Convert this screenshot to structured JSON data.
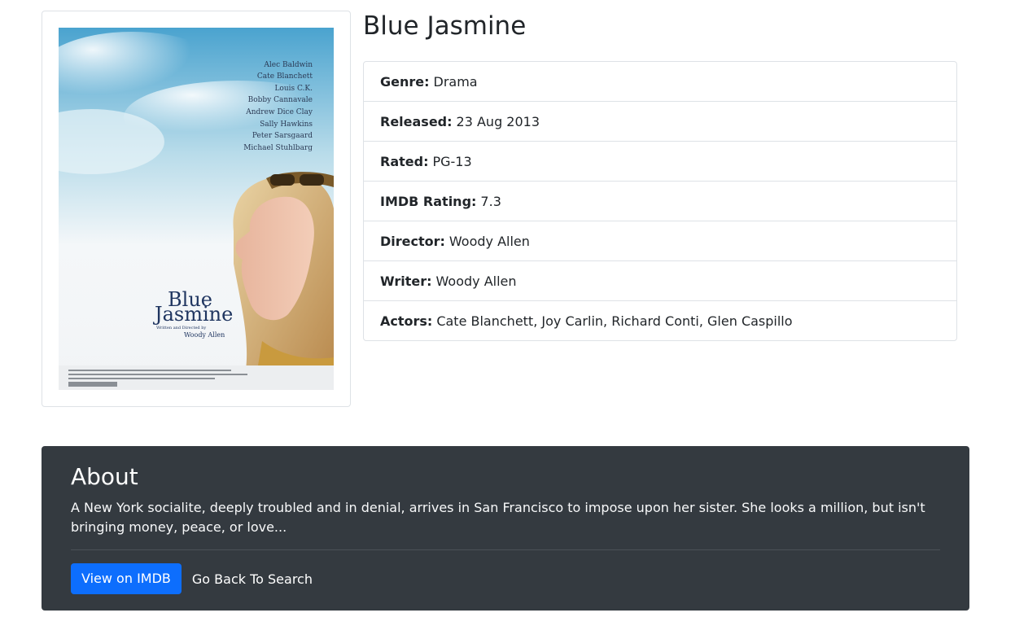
{
  "movie": {
    "title": "Blue Jasmine",
    "poster": {
      "cast": [
        "Alec Baldwin",
        "Cate Blanchett",
        "Louis C.K.",
        "Bobby Cannavale",
        "Andrew Dice Clay",
        "Sally Hawkins",
        "Peter Sarsgaard",
        "Michael Stuhlbarg"
      ],
      "title_line1": "Blue",
      "title_line2": "Jasmine",
      "credit_small": "Written and Directed by",
      "credit_name": "Woody Allen"
    },
    "details": [
      {
        "label": "Genre:",
        "value": "Drama"
      },
      {
        "label": "Released:",
        "value": "23 Aug 2013"
      },
      {
        "label": "Rated:",
        "value": "PG-13"
      },
      {
        "label": "IMDB Rating:",
        "value": "7.3"
      },
      {
        "label": "Director:",
        "value": "Woody Allen"
      },
      {
        "label": "Writer:",
        "value": "Woody Allen"
      },
      {
        "label": "Actors:",
        "value": "Cate Blanchett, Joy Carlin, Richard Conti, Glen Caspillo"
      }
    ]
  },
  "about": {
    "heading": "About",
    "plot": "A New York socialite, deeply troubled and in denial, arrives in San Francisco to impose upon her sister. She looks a million, but isn't bringing money, peace, or love...",
    "imdb_button": "View on IMDB",
    "back_link": "Go Back To Search"
  },
  "colors": {
    "primary": "#0d6efd",
    "about_bg": "#343a40",
    "border": "#dee2e6"
  }
}
